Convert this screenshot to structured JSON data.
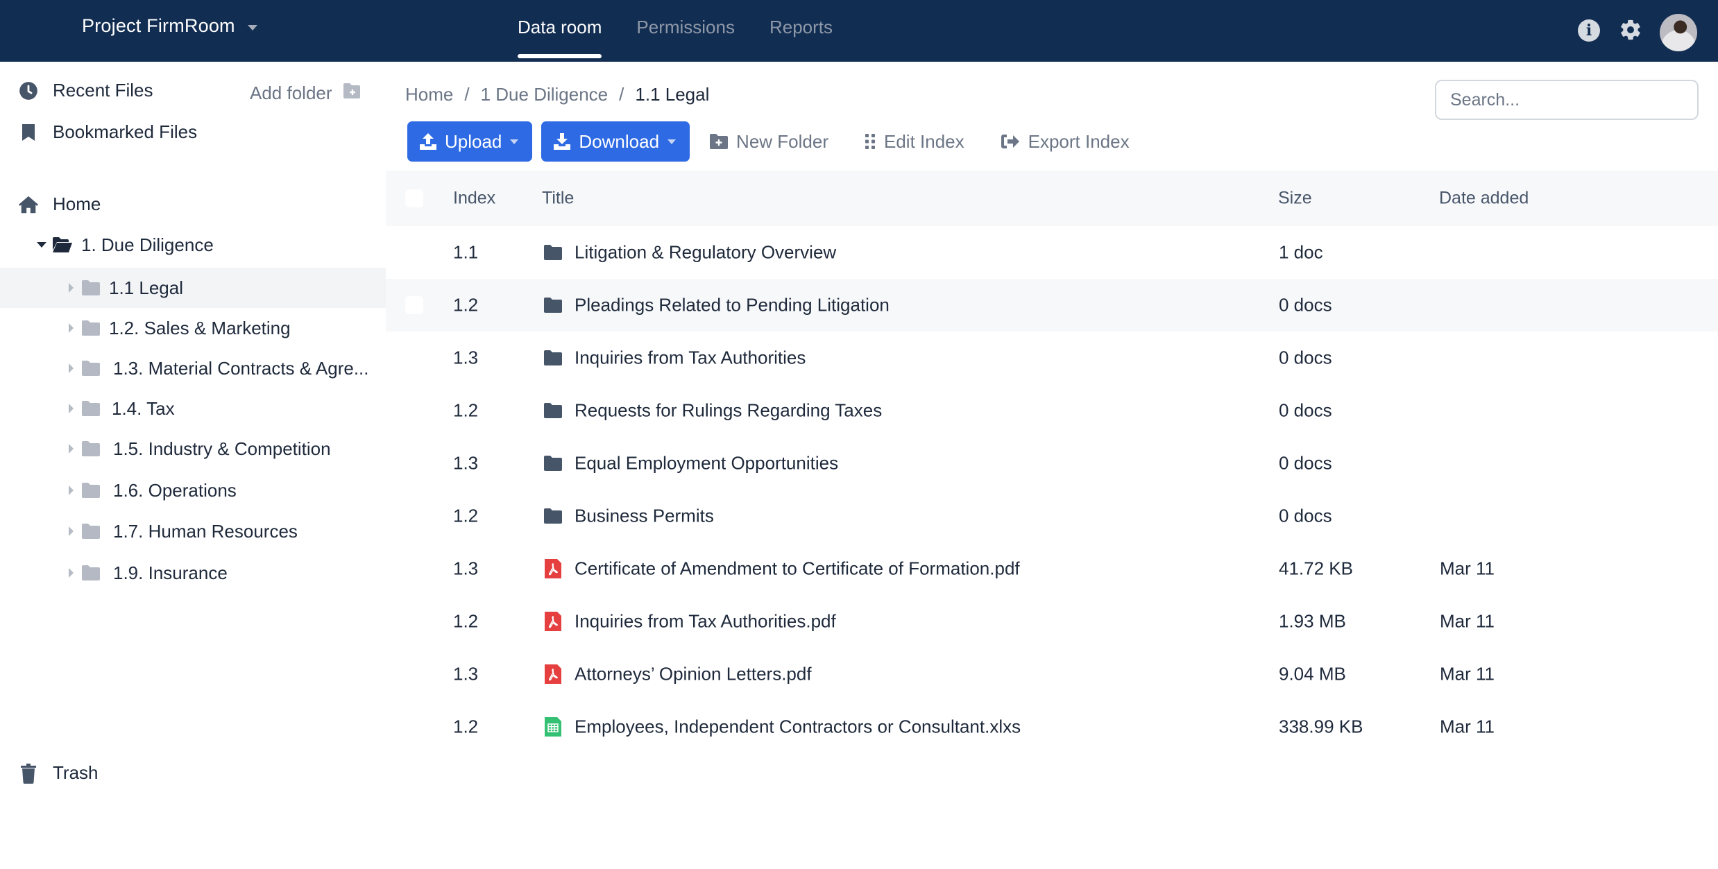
{
  "header": {
    "project_name": "Project FirmRoom",
    "nav": [
      {
        "label": "Data room",
        "active": true
      },
      {
        "label": "Permissions",
        "active": false
      },
      {
        "label": "Reports",
        "active": false
      }
    ],
    "icons": [
      "info-icon",
      "gear-icon",
      "avatar"
    ]
  },
  "sidebar": {
    "recent_files": "Recent Files",
    "add_folder": "Add folder",
    "bookmarked_files": "Bookmarked Files",
    "home": "Home",
    "root_folder": "1. Due Diligence",
    "folders": [
      {
        "label": "1.1 Legal",
        "selected": true
      },
      {
        "label": "1.2. Sales & Marketing",
        "selected": false
      },
      {
        "label": "1.3. Material Contracts & Agre...",
        "selected": false
      },
      {
        "label": "1.4. Tax",
        "selected": false
      },
      {
        "label": "1.5. Industry & Competition",
        "selected": false
      },
      {
        "label": "1.6. Operations",
        "selected": false
      },
      {
        "label": "1.7. Human Resources",
        "selected": false
      },
      {
        "label": "1.9. Insurance",
        "selected": false
      }
    ],
    "trash": "Trash"
  },
  "breadcrumb": {
    "items": [
      "Home",
      "1 Due Diligence",
      "1.1 Legal"
    ],
    "separator": "/"
  },
  "search": {
    "placeholder": "Search...",
    "value": ""
  },
  "toolbar": {
    "upload": "Upload",
    "download": "Download",
    "new_folder": "New Folder",
    "edit_index": "Edit Index",
    "export_index": "Export Index"
  },
  "table": {
    "columns": {
      "index": "Index",
      "title": "Title",
      "size": "Size",
      "date": "Date added"
    },
    "rows": [
      {
        "index": "1.1",
        "type": "folder",
        "title": "Litigation & Regulatory Overview",
        "size": "1 doc",
        "date": ""
      },
      {
        "index": "1.2",
        "type": "folder",
        "title": "Pleadings Related to Pending Litigation",
        "size": "0 docs",
        "date": ""
      },
      {
        "index": "1.3",
        "type": "folder",
        "title": "Inquiries from Tax Authorities",
        "size": "0 docs",
        "date": ""
      },
      {
        "index": "1.2",
        "type": "folder",
        "title": "Requests for Rulings Regarding Taxes",
        "size": "0 docs",
        "date": ""
      },
      {
        "index": "1.3",
        "type": "folder",
        "title": "Equal Employment Opportunities",
        "size": "0 docs",
        "date": ""
      },
      {
        "index": "1.2",
        "type": "folder",
        "title": "Business Permits",
        "size": "0 docs",
        "date": ""
      },
      {
        "index": "1.3",
        "type": "pdf",
        "title": "Certificate of Amendment to Certificate of Formation.pdf",
        "size": "41.72 KB",
        "date": "Mar 11"
      },
      {
        "index": "1.2",
        "type": "pdf",
        "title": "Inquiries from Tax Authorities.pdf",
        "size": "1.93 MB",
        "date": "Mar 11"
      },
      {
        "index": "1.3",
        "type": "pdf",
        "title": "Attorneys’ Opinion Letters.pdf",
        "size": "9.04 MB",
        "date": "Mar 11"
      },
      {
        "index": "1.2",
        "type": "xlsx",
        "title": "Employees, Independent Contractors or Consultant.xlxs",
        "size": "338.99 KB",
        "date": "Mar 11"
      }
    ]
  },
  "colors": {
    "topbar": "#122d52",
    "primary_button": "#2d6ae3",
    "pdf_icon": "#e5403f",
    "xlsx_icon": "#34c173",
    "folder_dark": "#475569",
    "folder_light": "#b4b9c4"
  }
}
